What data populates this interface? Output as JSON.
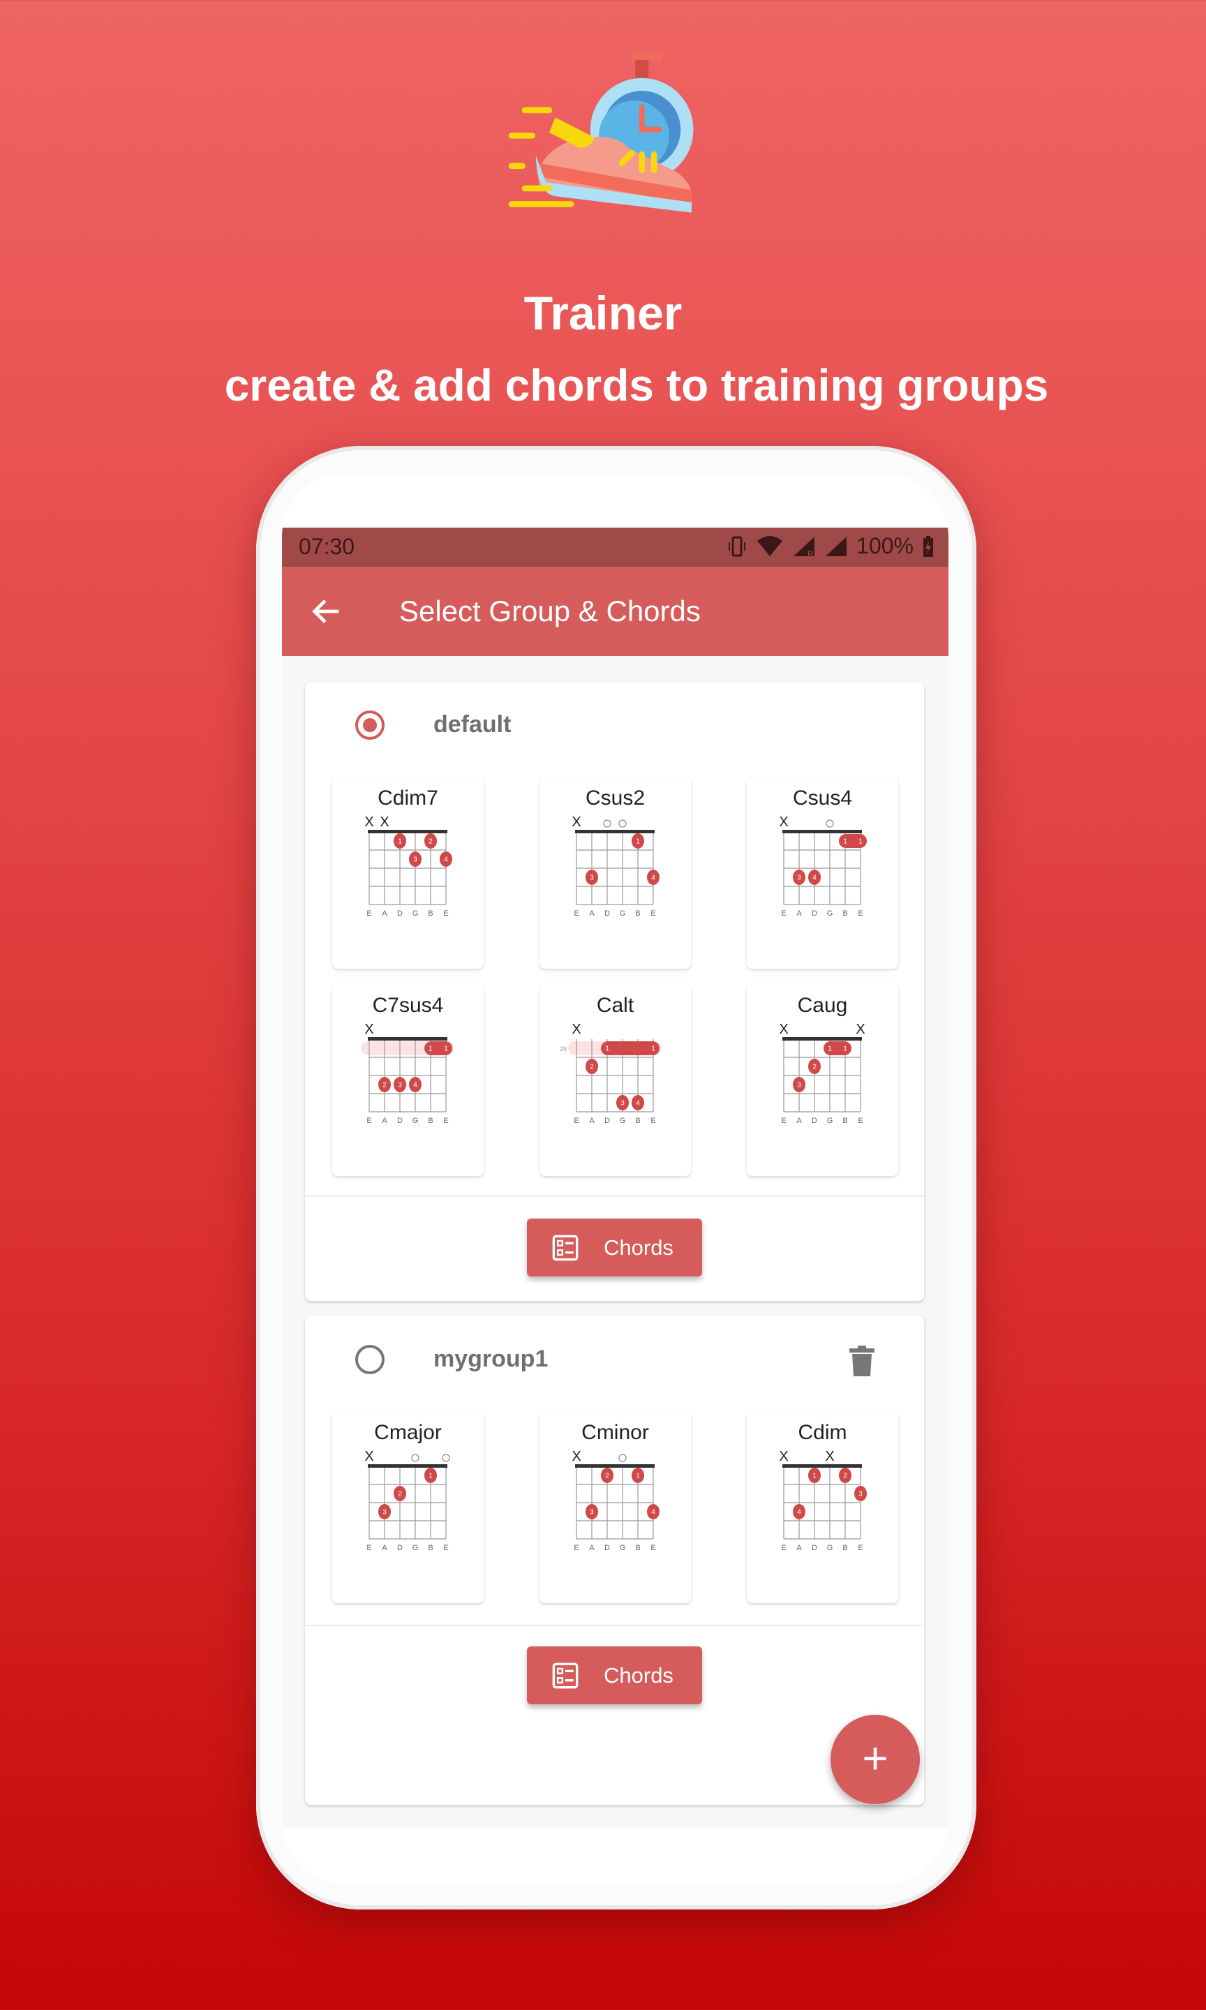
{
  "promo": {
    "title": "Trainer",
    "subtitle": "create & add chords to training groups",
    "logo_icon": "running-shoe-stopwatch-icon"
  },
  "status_bar": {
    "time": "07:30",
    "battery": "100%",
    "icons": [
      "vibrate-icon",
      "wifi-icon",
      "signal-roaming-icon",
      "signal-icon",
      "battery-charging-icon"
    ]
  },
  "app_bar": {
    "title": "Select Group & Chords",
    "back_icon": "arrow-back-icon"
  },
  "colors": {
    "primary": "#d65b5b",
    "status_bar": "#9f4a49",
    "dot": "#d04848",
    "background_top": "#ef6464",
    "background_bottom": "#c40606"
  },
  "string_labels": [
    "E",
    "A",
    "D",
    "G",
    "B",
    "E"
  ],
  "groups": [
    {
      "name": "default",
      "selected": true,
      "deletable": false,
      "button_label": "Chords",
      "chords": [
        {
          "name": "Cdim7",
          "markers": [
            "x",
            "x",
            "",
            "",
            "",
            ""
          ],
          "dots": [
            {
              "s": 2,
              "f": 1,
              "n": "1"
            },
            {
              "s": 4,
              "f": 1,
              "n": "2"
            },
            {
              "s": 3,
              "f": 2,
              "n": "3"
            },
            {
              "s": 5,
              "f": 2,
              "n": "4"
            }
          ],
          "barres": []
        },
        {
          "name": "Csus2",
          "markers": [
            "x",
            "",
            "o",
            "o",
            "",
            ""
          ],
          "dots": [
            {
              "s": 4,
              "f": 1,
              "n": "1"
            },
            {
              "s": 1,
              "f": 3,
              "n": "3"
            },
            {
              "s": 5,
              "f": 3,
              "n": "4"
            }
          ],
          "barres": []
        },
        {
          "name": "Csus4",
          "markers": [
            "x",
            "",
            "",
            "o",
            "",
            ""
          ],
          "dots": [
            {
              "s": 1,
              "f": 3,
              "n": "3"
            },
            {
              "s": 2,
              "f": 3,
              "n": "4"
            }
          ],
          "barres": [
            {
              "f": 1,
              "from": 4,
              "to": 5,
              "n": "1",
              "shadow": false
            }
          ]
        },
        {
          "name": "C7sus4",
          "markers": [
            "x",
            "",
            "",
            "",
            "",
            ""
          ],
          "dots": [
            {
              "s": 1,
              "f": 3,
              "n": "2"
            },
            {
              "s": 2,
              "f": 3,
              "n": "3"
            },
            {
              "s": 3,
              "f": 3,
              "n": "4"
            }
          ],
          "barres": [
            {
              "f": 1,
              "from": 4,
              "to": 5,
              "n": "1",
              "shadow": true
            }
          ]
        },
        {
          "name": "Calt",
          "markers": [
            "x",
            "",
            "",
            "",
            "",
            ""
          ],
          "start_fret": "2fr",
          "dots": [
            {
              "s": 1,
              "f": 2,
              "n": "2"
            },
            {
              "s": 3,
              "f": 4,
              "n": "3"
            },
            {
              "s": 4,
              "f": 4,
              "n": "4"
            }
          ],
          "barres": [
            {
              "f": 1,
              "from": 2,
              "to": 5,
              "n": "1",
              "shadow": true
            }
          ]
        },
        {
          "name": "Caug",
          "markers": [
            "x",
            "",
            "",
            "",
            "",
            "x"
          ],
          "dots": [
            {
              "s": 2,
              "f": 2,
              "n": "2"
            },
            {
              "s": 1,
              "f": 3,
              "n": "3"
            }
          ],
          "barres": [
            {
              "f": 1,
              "from": 3,
              "to": 4,
              "n": "1",
              "shadow": false
            }
          ]
        }
      ]
    },
    {
      "name": "mygroup1",
      "selected": false,
      "deletable": true,
      "button_label": "Chords",
      "chords": [
        {
          "name": "Cmajor",
          "markers": [
            "x",
            "",
            "",
            "o",
            "",
            "o"
          ],
          "dots": [
            {
              "s": 4,
              "f": 1,
              "n": "1"
            },
            {
              "s": 2,
              "f": 2,
              "n": "2"
            },
            {
              "s": 1,
              "f": 3,
              "n": "3"
            }
          ],
          "barres": []
        },
        {
          "name": "Cminor",
          "markers": [
            "x",
            "",
            "",
            "o",
            "",
            ""
          ],
          "dots": [
            {
              "s": 2,
              "f": 1,
              "n": "2"
            },
            {
              "s": 4,
              "f": 1,
              "n": "1"
            },
            {
              "s": 1,
              "f": 3,
              "n": "3"
            },
            {
              "s": 5,
              "f": 3,
              "n": "4"
            }
          ],
          "barres": []
        },
        {
          "name": "Cdim",
          "markers": [
            "x",
            "",
            "",
            "x",
            "",
            ""
          ],
          "dots": [
            {
              "s": 2,
              "f": 1,
              "n": "1"
            },
            {
              "s": 4,
              "f": 1,
              "n": "2"
            },
            {
              "s": 5,
              "f": 2,
              "n": "3"
            },
            {
              "s": 1,
              "f": 3,
              "n": "4"
            }
          ],
          "barres": []
        }
      ]
    }
  ],
  "fab": {
    "label": "+",
    "icon": "add-icon"
  }
}
